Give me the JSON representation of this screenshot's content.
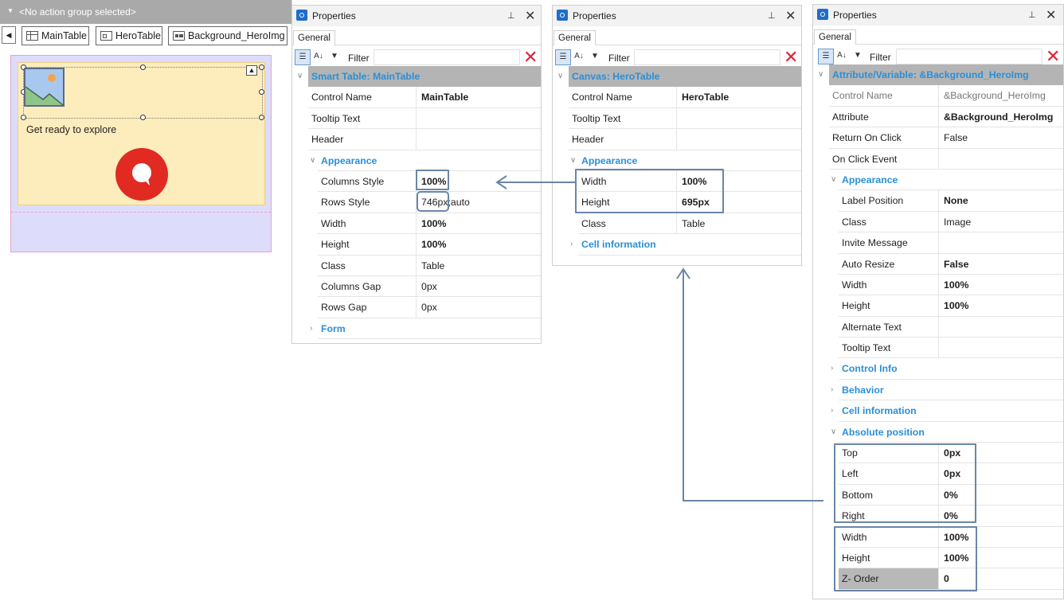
{
  "designer": {
    "action_group": "<No action group selected>",
    "breadcrumbs": [
      "MainTable",
      "HeroTable",
      "Background_HeroImg"
    ],
    "hero_text": "Get ready to explore"
  },
  "panels": [
    {
      "title": "Properties",
      "tab": "General",
      "filter_label": "Filter",
      "header": "Smart Table: MainTable",
      "rows": [
        {
          "name": "Control Name",
          "value": "MainTable",
          "bold": true
        },
        {
          "name": "Tooltip Text",
          "value": ""
        },
        {
          "name": "Header",
          "value": ""
        },
        {
          "category": "Appearance",
          "open": true
        },
        {
          "name": "Columns Style",
          "value": "100%",
          "bold": true,
          "indent": true
        },
        {
          "name": "Rows Style",
          "value": "746px;auto",
          "indent": true
        },
        {
          "name": "Width",
          "value": "100%",
          "bold": true,
          "indent": true
        },
        {
          "name": "Height",
          "value": "100%",
          "bold": true,
          "indent": true
        },
        {
          "name": "Class",
          "value": "Table",
          "indent": true
        },
        {
          "name": "Columns Gap",
          "value": "0px",
          "indent": true
        },
        {
          "name": "Rows Gap",
          "value": "0px",
          "indent": true
        },
        {
          "category": "Form",
          "open": false
        }
      ]
    },
    {
      "title": "Properties",
      "tab": "General",
      "filter_label": "Filter",
      "header": "Canvas: HeroTable",
      "rows": [
        {
          "name": "Control Name",
          "value": "HeroTable",
          "bold": true
        },
        {
          "name": "Tooltip Text",
          "value": ""
        },
        {
          "name": "Header",
          "value": ""
        },
        {
          "category": "Appearance",
          "open": true
        },
        {
          "name": "Width",
          "value": "100%",
          "bold": true,
          "indent": true
        },
        {
          "name": "Height",
          "value": "695px",
          "bold": true,
          "indent": true
        },
        {
          "name": "Class",
          "value": "Table",
          "indent": true
        },
        {
          "category": "Cell information",
          "open": false
        }
      ]
    },
    {
      "title": "Properties",
      "tab": "General",
      "filter_label": "Filter",
      "header": "Attribute/Variable: &Background_HeroImg",
      "rows": [
        {
          "name": "Control Name",
          "value": "&Background_HeroImg",
          "dim": true
        },
        {
          "name": "Attribute",
          "value": "&Background_HeroImg",
          "bold": true
        },
        {
          "name": "Return On Click",
          "value": "False"
        },
        {
          "name": "On Click Event",
          "value": ""
        },
        {
          "category": "Appearance",
          "open": true
        },
        {
          "name": "Label Position",
          "value": "None",
          "bold": true,
          "indent": true
        },
        {
          "name": "Class",
          "value": "Image",
          "indent": true
        },
        {
          "name": "Invite Message",
          "value": "",
          "indent": true
        },
        {
          "name": "Auto Resize",
          "value": "False",
          "bold": true,
          "indent": true
        },
        {
          "name": "Width",
          "value": "100%",
          "bold": true,
          "indent": true
        },
        {
          "name": "Height",
          "value": "100%",
          "bold": true,
          "indent": true
        },
        {
          "name": "Alternate Text",
          "value": "",
          "indent": true
        },
        {
          "name": "Tooltip Text",
          "value": "",
          "indent": true
        },
        {
          "category": "Control Info",
          "open": false
        },
        {
          "category": "Behavior",
          "open": false
        },
        {
          "category": "Cell information",
          "open": false
        },
        {
          "category": "Absolute position",
          "open": true
        },
        {
          "name": "Top",
          "value": "0px",
          "bold": true,
          "indent": true
        },
        {
          "name": "Left",
          "value": "0px",
          "bold": true,
          "indent": true
        },
        {
          "name": "Bottom",
          "value": "0%",
          "bold": true,
          "indent": true
        },
        {
          "name": "Right",
          "value": "0%",
          "bold": true,
          "indent": true
        },
        {
          "name": "Width",
          "value": "100%",
          "bold": true,
          "indent": true
        },
        {
          "name": "Height",
          "value": "100%",
          "bold": true,
          "indent": true
        },
        {
          "name": "Z- Order",
          "value": "0",
          "bold": true,
          "indent": true,
          "selected": true
        }
      ]
    }
  ],
  "colors": {
    "accent_blue": "#2a8fd8",
    "filter_clear": "#e0223a",
    "highlight_box": "#6a86a8",
    "chat_button": "#e02a22"
  },
  "icons": [
    "gear-icon",
    "pin-icon",
    "close-icon",
    "categorized-icon",
    "sort-az-icon",
    "filter-icon",
    "clear-filter-icon",
    "image-icon",
    "chat-icon",
    "up-arrow-icon",
    "table-icon",
    "canvas-icon",
    "attribute-icon"
  ]
}
